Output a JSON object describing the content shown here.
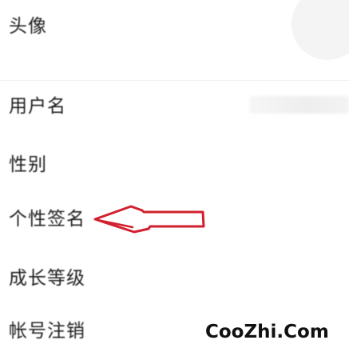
{
  "profile_settings": {
    "rows": [
      {
        "label": "头像"
      },
      {
        "label": "用户名"
      },
      {
        "label": "性别"
      },
      {
        "label": "个性签名"
      },
      {
        "label": "成长等级"
      },
      {
        "label": "帐号注销"
      }
    ]
  },
  "colors": {
    "annotation_arrow": "#d2202e",
    "divider": "#f0f0f0"
  },
  "watermark": {
    "text": "CooZhi.Com"
  }
}
